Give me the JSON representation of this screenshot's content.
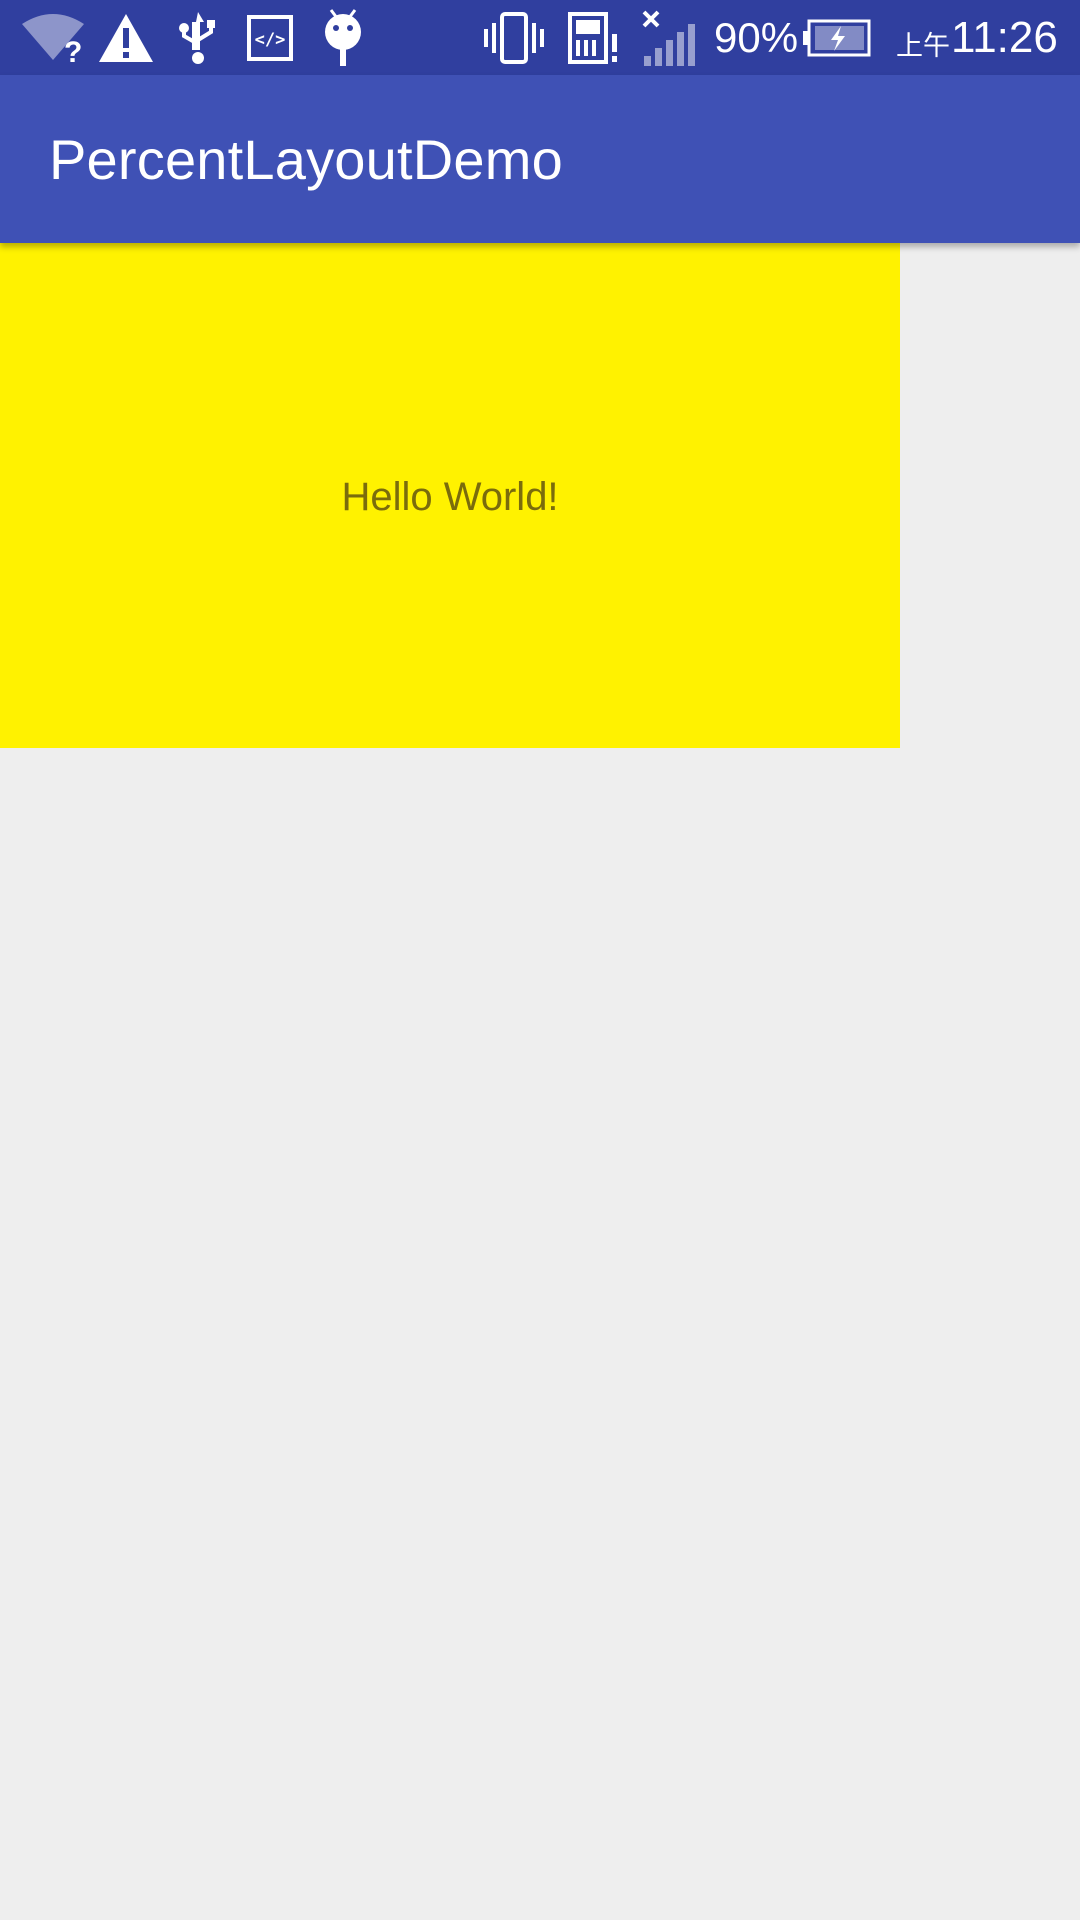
{
  "status_bar": {
    "background": "#303f9f",
    "icons": [
      "wifi-unknown-icon",
      "warning-icon",
      "usb-icon",
      "code-icon",
      "android-debug-icon",
      "vibrate-icon",
      "sd-card-alert-icon",
      "signal-no-service-icon",
      "battery-charging-icon"
    ],
    "battery_percent": "90%",
    "ampm": "上午",
    "time": "11:26"
  },
  "app_bar": {
    "title": "PercentLayoutDemo",
    "color": "#3f51b5"
  },
  "content": {
    "box_color": "#fff200",
    "text": "Hello World!"
  }
}
